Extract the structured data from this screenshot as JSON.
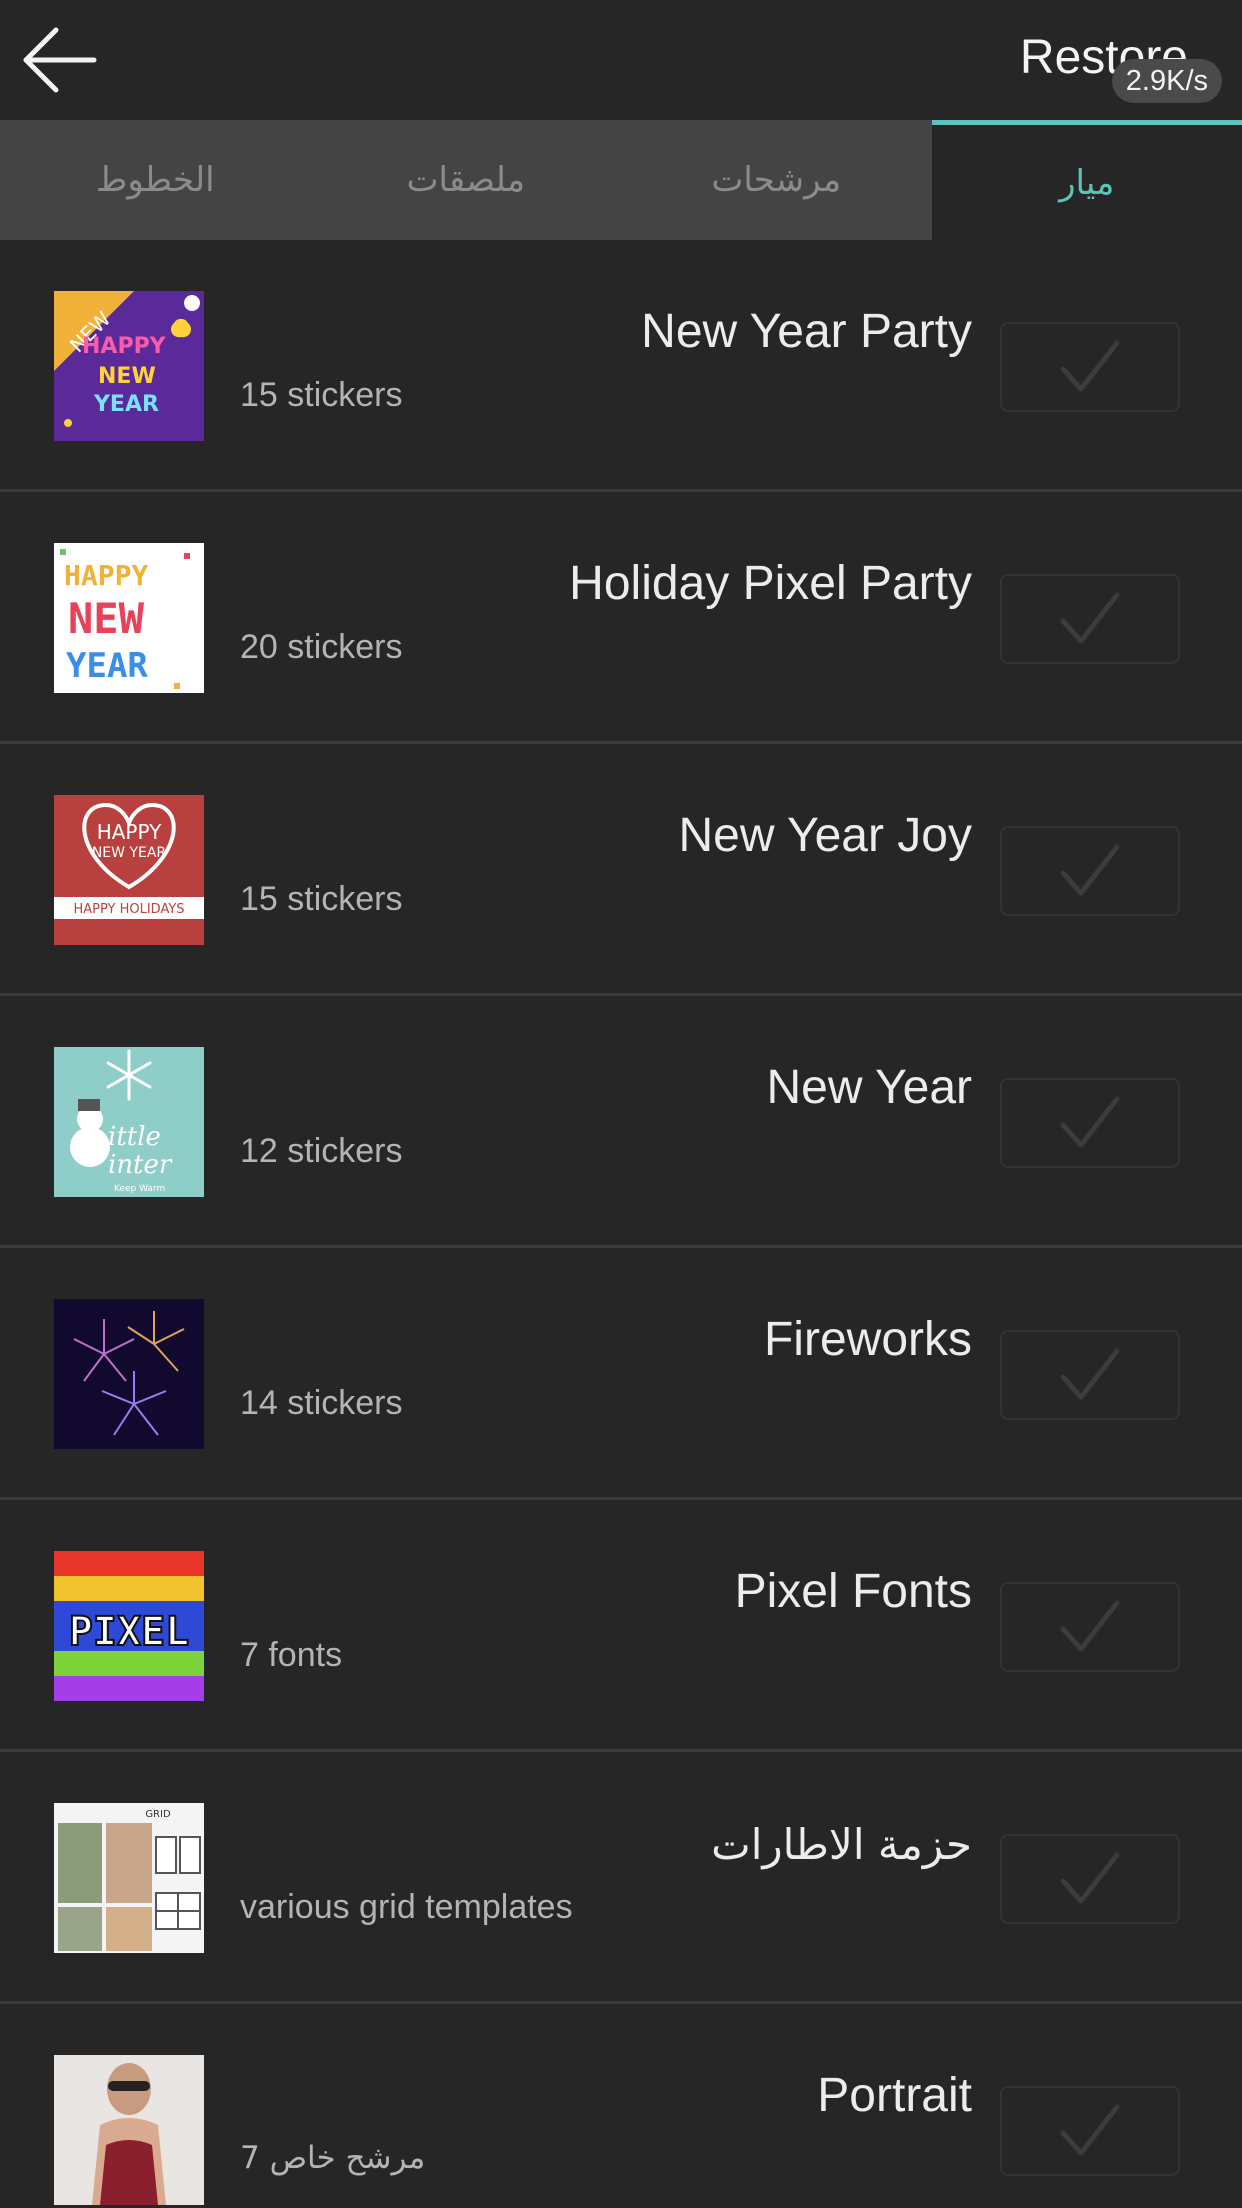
{
  "header": {
    "restore_label": "Restore",
    "network_speed": "2.9K/s",
    "back_icon": "back-arrow-icon"
  },
  "tabs": [
    {
      "label": "الخطوط",
      "active": false
    },
    {
      "label": "ملصقات",
      "active": false
    },
    {
      "label": "مرشحات",
      "active": false
    },
    {
      "label": "ميار",
      "active": true
    }
  ],
  "accent_color": "#5fc1b7",
  "packs": [
    {
      "title": "New Year Party",
      "subtitle": "15 stickers",
      "thumb_icon": "new-year-party-thumbnail",
      "thumb_text": [
        "NEW",
        "HAPPY",
        "NEW",
        "YEAR"
      ]
    },
    {
      "title": "Holiday Pixel Party",
      "subtitle": "20 stickers",
      "thumb_icon": "holiday-pixel-party-thumbnail",
      "thumb_text": [
        "HAPPY",
        "NEW",
        "YEAR"
      ]
    },
    {
      "title": "New Year Joy",
      "subtitle": "15 stickers",
      "thumb_icon": "new-year-joy-thumbnail",
      "thumb_text": [
        "HAPPY",
        "NEW YEAR",
        "HAPPY HOLIDAYS"
      ]
    },
    {
      "title": "New Year",
      "subtitle": "12 stickers",
      "thumb_icon": "little-winter-thumbnail",
      "thumb_text": [
        "ittle",
        "inter",
        "Keep Warm"
      ]
    },
    {
      "title": "Fireworks",
      "subtitle": "14 stickers",
      "thumb_icon": "fireworks-thumbnail",
      "thumb_text": []
    },
    {
      "title": "Pixel Fonts",
      "subtitle": "7 fonts",
      "thumb_icon": "pixel-fonts-thumbnail",
      "thumb_text": [
        "PIXEL"
      ]
    },
    {
      "title": "حزمة الاطارات",
      "subtitle": "various grid templates",
      "thumb_icon": "grid-templates-thumbnail",
      "thumb_text": [
        "GRID"
      ]
    },
    {
      "title": "Portrait",
      "subtitle": "7 مرشح خاص",
      "thumb_icon": "portrait-thumbnail",
      "thumb_text": []
    }
  ]
}
